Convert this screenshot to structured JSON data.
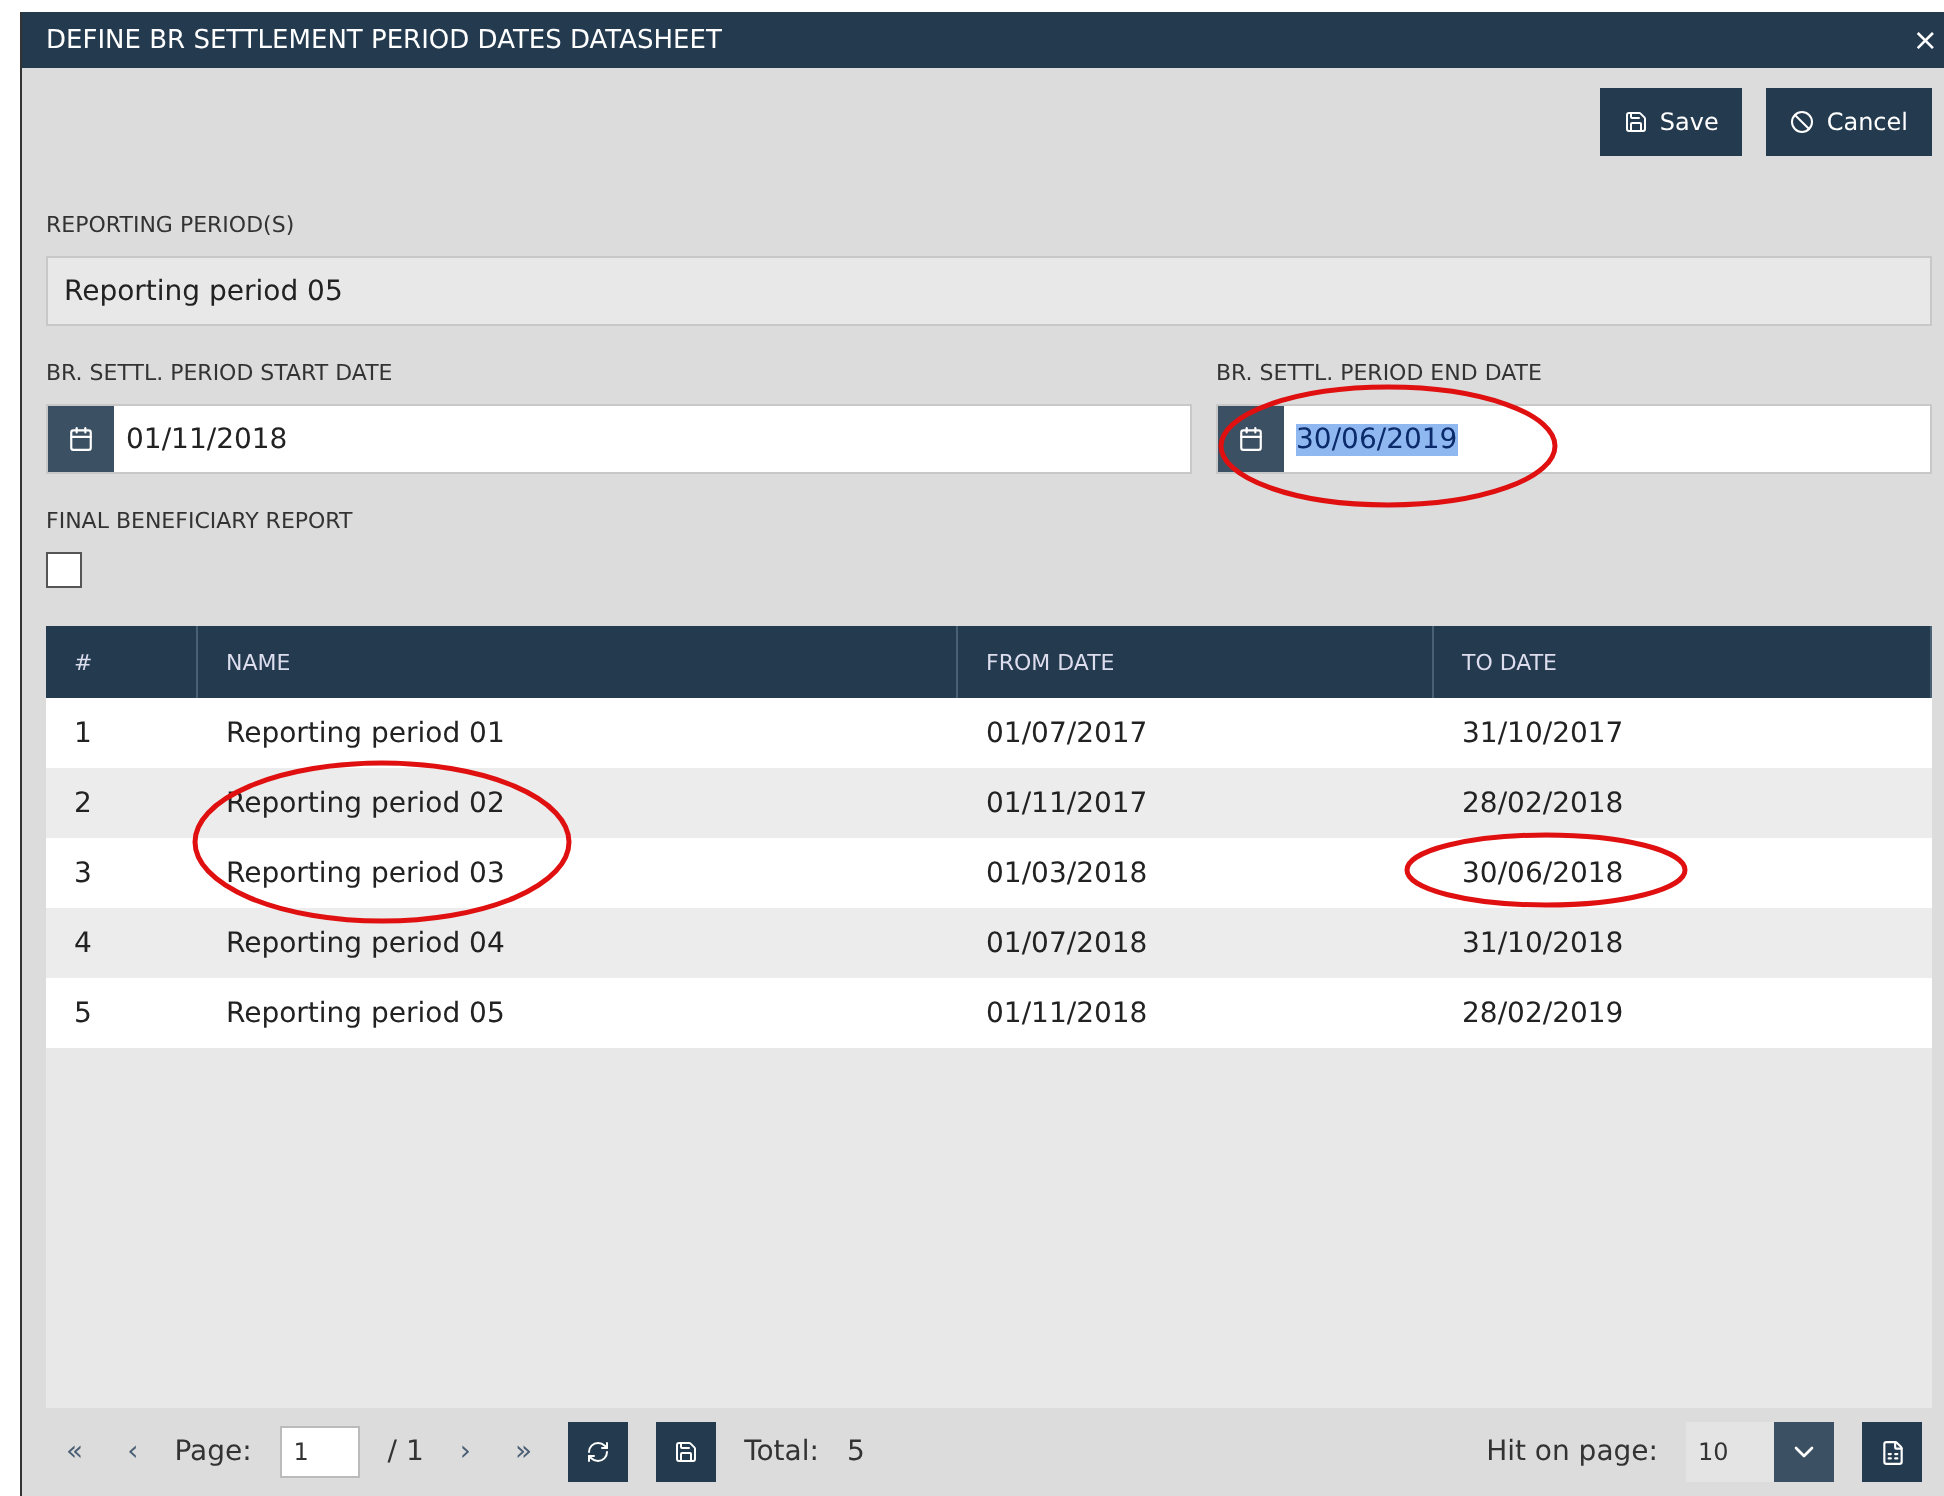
{
  "window": {
    "title": "DEFINE BR SETTLEMENT PERIOD DATES DATASHEET",
    "close": "×"
  },
  "toolbar": {
    "buttons": [
      {
        "kind": "save",
        "label": "Save"
      },
      {
        "kind": "cancel",
        "label": "Cancel"
      }
    ]
  },
  "reporting_period": {
    "label": "REPORTING PERIOD(S)",
    "value": "Reporting period 05"
  },
  "start_date": {
    "label": "BR. SETTL. PERIOD START DATE",
    "value": "01/11/2018",
    "highlighted": false
  },
  "end_date": {
    "label": "BR. SETTL. PERIOD END DATE",
    "value": "30/06/2019",
    "highlighted": true
  },
  "final_report": {
    "label": "FINAL BENEFICIARY REPORT",
    "checked": false
  },
  "table": {
    "columns": [
      "#",
      "NAME",
      "FROM DATE",
      "TO DATE"
    ],
    "rows": [
      {
        "cells": [
          "1",
          "Reporting period 01",
          "01/07/2017",
          "31/10/2017"
        ]
      },
      {
        "cells": [
          "2",
          "Reporting period 02",
          "01/11/2017",
          "28/02/2018"
        ]
      },
      {
        "cells": [
          "3",
          "Reporting period 03",
          "01/03/2018",
          "30/06/2018"
        ]
      },
      {
        "cells": [
          "4",
          "Reporting period 04",
          "01/07/2018",
          "31/10/2018"
        ]
      },
      {
        "cells": [
          "5",
          "Reporting period 05",
          "01/11/2018",
          "28/02/2019"
        ]
      }
    ]
  },
  "pager": {
    "first": "«",
    "prev": "‹",
    "page_label": "Page:",
    "page": "1",
    "of": "/ 1",
    "next": "›",
    "last": "»",
    "total_label": "Total:",
    "total": "5",
    "hits_label": "Hit on page:",
    "hits": "10"
  },
  "annotations": [
    {
      "kind": "end-date"
    },
    {
      "kind": "names"
    },
    {
      "kind": "to-date"
    }
  ]
}
